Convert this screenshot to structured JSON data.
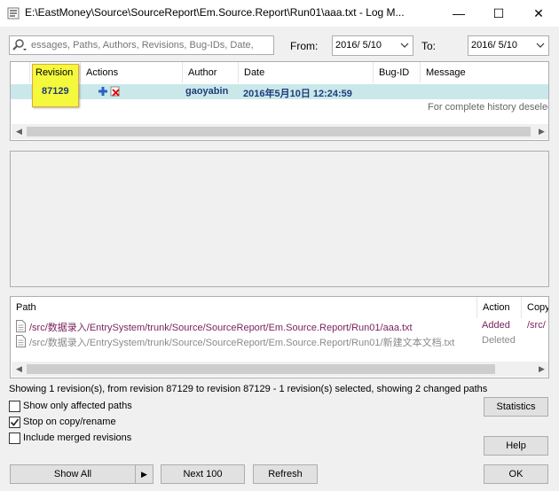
{
  "window": {
    "title": "E:\\EastMoney\\Source\\SourceReport\\Em.Source.Report\\Run01\\aaa.txt - Log M...",
    "minimize_glyph": "—",
    "maximize_glyph": "☐",
    "close_glyph": "✕"
  },
  "filter": {
    "search_placeholder": "essages, Paths, Authors, Revisions, Bug-IDs, Date,",
    "from_label": "From:",
    "from_value": "2016/  5/10",
    "to_label": "To:",
    "to_value": "2016/  5/10"
  },
  "revisions": {
    "columns": [
      "Revision",
      "Actions",
      "Author",
      "Date",
      "Bug-ID",
      "Message"
    ],
    "rows": [
      {
        "revision": "87129",
        "author": "gaoyabin",
        "date": "2016年5月10日 12:24:59",
        "bug_id": "",
        "message": ""
      }
    ],
    "hint": "For complete history deselect"
  },
  "paths": {
    "columns": [
      "Path",
      "Action",
      "Copy"
    ],
    "rows": [
      {
        "path": "/src/数据录入/EntrySystem/trunk/Source/SourceReport/Em.Source.Report/Run01/aaa.txt",
        "action": "Added",
        "copy": "/src/"
      },
      {
        "path": "/src/数据录入/EntrySystem/trunk/Source/SourceReport/Em.Source.Report/Run01/新建文本文档.txt",
        "action": "Deleted",
        "copy": ""
      }
    ],
    "colors": {
      "added": "#7a1f5c",
      "deleted": "#8a8a8a"
    }
  },
  "status": "Showing 1 revision(s), from revision 87129 to revision 87129 - 1 revision(s) selected, showing 2 changed paths",
  "options": {
    "show_only_affected": {
      "label": "Show only affected paths",
      "checked": false
    },
    "stop_on_copy": {
      "label": "Stop on copy/rename",
      "checked": true
    },
    "include_merged": {
      "label": "Include merged revisions",
      "checked": false
    }
  },
  "buttons": {
    "statistics": "Statistics",
    "help": "Help",
    "show_all": "Show All",
    "next_100": "Next 100",
    "refresh": "Refresh",
    "ok": "OK"
  },
  "icons": {
    "app": "log-icon",
    "search": "magnifier-icon",
    "action_add": "add-icon",
    "action_delete": "delete-icon",
    "file": "file-icon"
  },
  "colors": {
    "selected_row": "#cae8ea",
    "revision_highlight": "#f4f93c",
    "row_text": "#1f3c7a"
  }
}
